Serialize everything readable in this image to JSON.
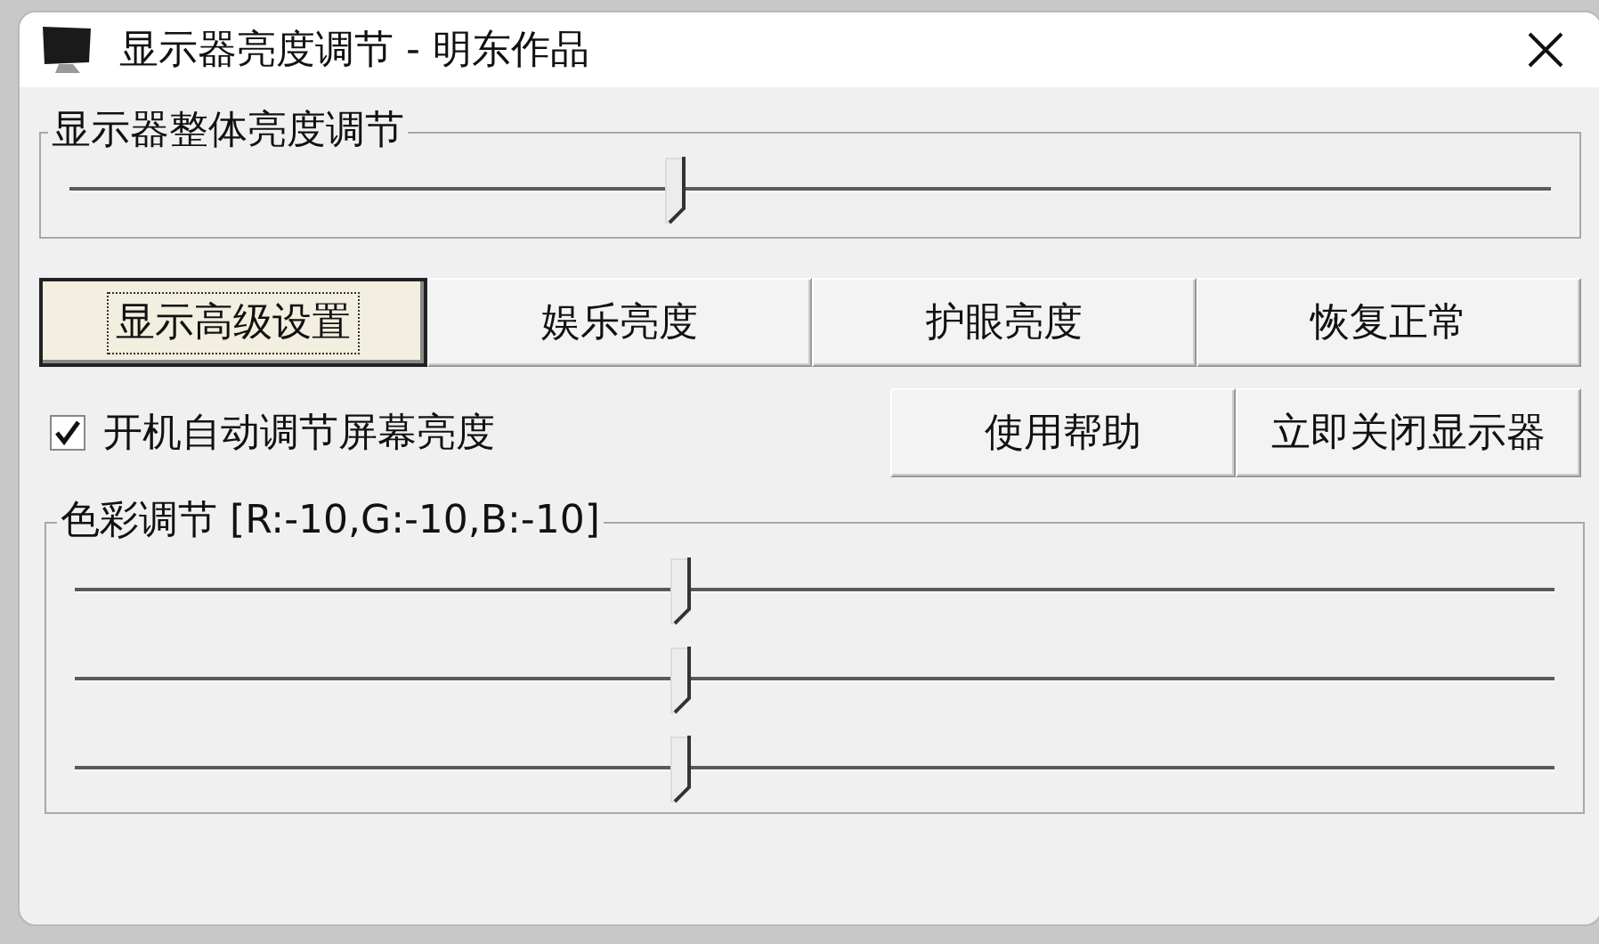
{
  "window": {
    "title": "显示器亮度调节 - 明东作品"
  },
  "brightness_group": {
    "title": "显示器整体亮度调节",
    "slider": {
      "level": 0.41
    }
  },
  "mode_buttons": [
    {
      "label": "显示高级设置",
      "focused": true
    },
    {
      "label": "娱乐亮度",
      "focused": false
    },
    {
      "label": "护眼亮度",
      "focused": false
    },
    {
      "label": "恢复正常",
      "focused": false
    }
  ],
  "autostart_checkbox": {
    "label": "开机自动调节屏幕亮度",
    "checked": true
  },
  "action_buttons": [
    {
      "label": "使用帮助",
      "focused": false
    },
    {
      "label": "立即关闭显示器",
      "focused": false
    }
  ],
  "color_group": {
    "title": "色彩调节 [R:-10,G:-10,B:-10]",
    "sliders": [
      {
        "level": 0.41
      },
      {
        "level": 0.41
      },
      {
        "level": 0.41
      }
    ]
  }
}
